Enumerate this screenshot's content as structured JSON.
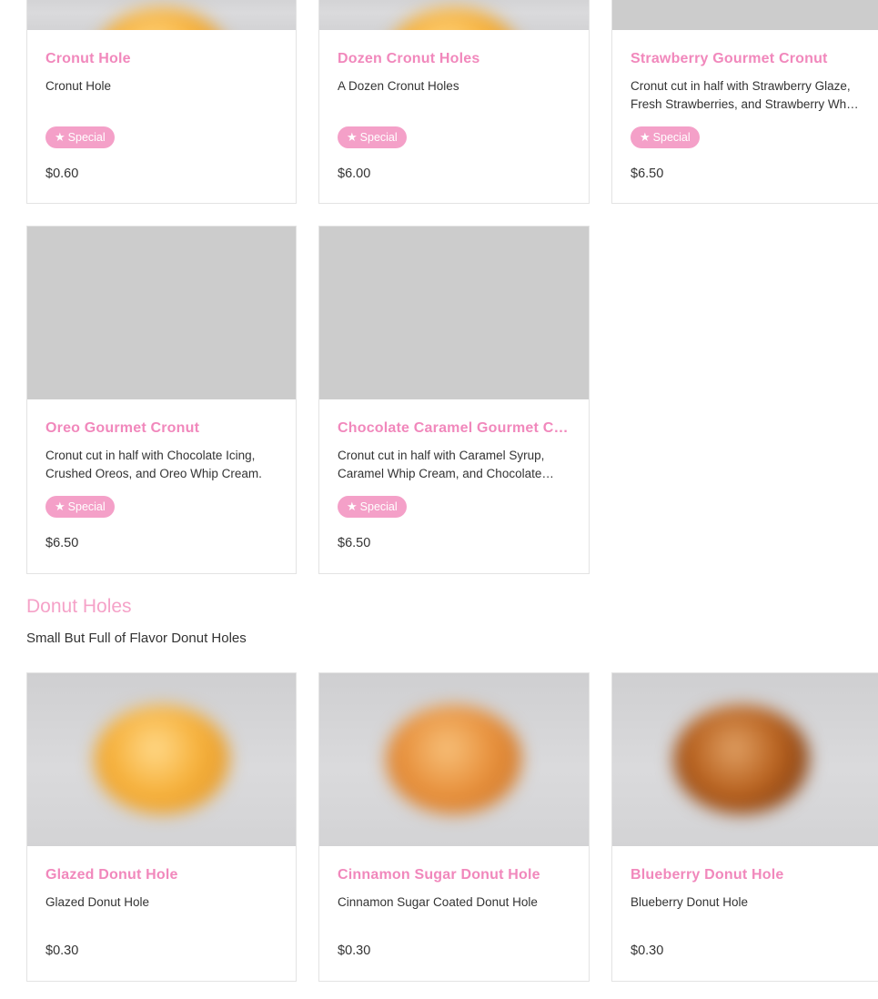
{
  "badge_label": "Special",
  "badge_icon": "star-icon",
  "accent_color": "#f188bc",
  "top_row": [
    {
      "title": "Cronut Hole",
      "description": "Cronut Hole",
      "special": true,
      "price": "$0.60"
    },
    {
      "title": "Dozen Cronut Holes",
      "description": "A Dozen Cronut Holes",
      "special": true,
      "price": "$6.00"
    },
    {
      "title": "Strawberry Gourmet Cronut",
      "description": "Cronut cut in half with Strawberry Glaze, Fresh Strawberries, and Strawberry Whip Cream.",
      "special": true,
      "price": "$6.50"
    }
  ],
  "second_row": [
    {
      "title": "Oreo Gourmet Cronut",
      "description": "Cronut cut in half with Chocolate Icing, Crushed Oreos, and Oreo Whip Cream.",
      "special": true,
      "price": "$6.50"
    },
    {
      "title": "Chocolate Caramel Gourmet Cronut",
      "description": "Cronut cut in half with Caramel Syrup, Caramel Whip Cream, and Chocolate Icing.",
      "special": true,
      "price": "$6.50"
    }
  ],
  "donut_holes_section": {
    "title": "Donut Holes",
    "description": "Small But Full of Flavor Donut Holes",
    "items": [
      {
        "title": "Glazed Donut Hole",
        "description": "Glazed Donut Hole",
        "price": "$0.30"
      },
      {
        "title": "Cinnamon Sugar Donut Hole",
        "description": "Cinnamon Sugar Coated Donut Hole",
        "price": "$0.30"
      },
      {
        "title": "Blueberry Donut Hole",
        "description": "Blueberry Donut Hole",
        "price": "$0.30"
      }
    ]
  }
}
